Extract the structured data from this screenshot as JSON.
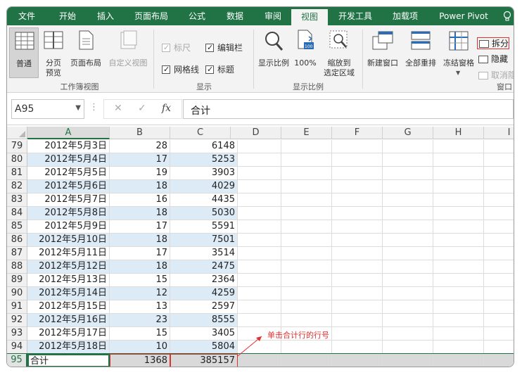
{
  "ribbon_tabs": [
    "文件",
    "开始",
    "插入",
    "页面布局",
    "公式",
    "数据",
    "审阅",
    "视图",
    "开发工具",
    "加载项",
    "Power Pivot"
  ],
  "active_tab": "视图",
  "groups": {
    "workbook_views": {
      "label": "工作簿视图",
      "normal": "普通",
      "page_break_1": "分页",
      "page_break_2": "预览",
      "page_layout": "页面布局",
      "custom_views": "自定义视图"
    },
    "show": {
      "label": "显示",
      "ruler": "标尺",
      "formula_bar": "编辑栏",
      "gridlines": "网格线",
      "headings": "标题"
    },
    "zoom": {
      "label": "显示比例",
      "zoom": "显示比例",
      "hundred": "100%",
      "zoom_sel_1": "缩放到",
      "zoom_sel_2": "选定区域",
      "badge": "100"
    },
    "window": {
      "label": "窗口",
      "new_window": "新建窗口",
      "arrange_all": "全部重排",
      "freeze_panes": "冻结窗格",
      "split": "拆分",
      "hide": "隐藏",
      "unhide": "取消隐藏"
    }
  },
  "formula_bar": {
    "name_box": "A95",
    "fx": "fx",
    "value": "合计"
  },
  "columns": [
    "A",
    "B",
    "C",
    "D",
    "E",
    "F",
    "G",
    "H",
    "I"
  ],
  "rows": [
    {
      "n": "79",
      "a": "2012年5月3日",
      "b": "28",
      "c": "6148"
    },
    {
      "n": "80",
      "a": "2012年5月4日",
      "b": "17",
      "c": "5253"
    },
    {
      "n": "81",
      "a": "2012年5月5日",
      "b": "19",
      "c": "3903"
    },
    {
      "n": "82",
      "a": "2012年5月6日",
      "b": "18",
      "c": "4029"
    },
    {
      "n": "83",
      "a": "2012年5月7日",
      "b": "16",
      "c": "4435"
    },
    {
      "n": "84",
      "a": "2012年5月8日",
      "b": "18",
      "c": "5030"
    },
    {
      "n": "85",
      "a": "2012年5月9日",
      "b": "17",
      "c": "5591"
    },
    {
      "n": "86",
      "a": "2012年5月10日",
      "b": "18",
      "c": "7501"
    },
    {
      "n": "87",
      "a": "2012年5月11日",
      "b": "17",
      "c": "3514"
    },
    {
      "n": "88",
      "a": "2012年5月12日",
      "b": "18",
      "c": "2475"
    },
    {
      "n": "89",
      "a": "2012年5月13日",
      "b": "15",
      "c": "2364"
    },
    {
      "n": "90",
      "a": "2012年5月14日",
      "b": "12",
      "c": "4259"
    },
    {
      "n": "91",
      "a": "2012年5月15日",
      "b": "13",
      "c": "2597"
    },
    {
      "n": "92",
      "a": "2012年5月16日",
      "b": "23",
      "c": "8555"
    },
    {
      "n": "93",
      "a": "2012年5月17日",
      "b": "15",
      "c": "3405"
    },
    {
      "n": "94",
      "a": "2012年5月18日",
      "b": "10",
      "c": "5804"
    }
  ],
  "total_row": {
    "n": "95",
    "a": "合计",
    "b": "1368",
    "c": "385157"
  },
  "annotation": "单击合计行的行号",
  "colors": {
    "excel_green": "#217346",
    "band_blue": "#ddebf7",
    "annotation_red": "#e03030"
  }
}
